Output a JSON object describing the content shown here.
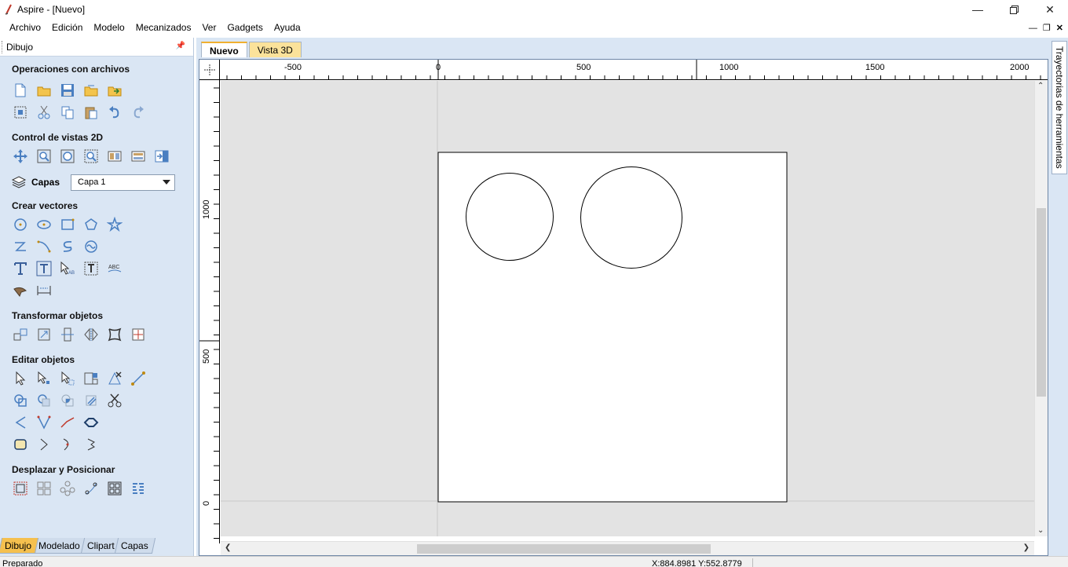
{
  "window": {
    "title": "Aspire - [Nuevo]"
  },
  "menu": [
    "Archivo",
    "Edición",
    "Modelo",
    "Mecanizados",
    "Ver",
    "Gadgets",
    "Ayuda"
  ],
  "left_panel": {
    "title": "Dibujo",
    "sections": {
      "file_ops": "Operaciones con archivos",
      "view_2d": "Control de vistas 2D",
      "create_vectors": "Crear vectores",
      "transform": "Transformar objetos",
      "edit": "Editar objetos",
      "nest": "Desplazar y Posicionar"
    },
    "layers": {
      "label": "Capas",
      "selected": "Capa 1"
    },
    "bottom_tabs": [
      "Dibujo",
      "Modelado",
      "Clipart",
      "Capas"
    ]
  },
  "doc_tabs": [
    "Nuevo",
    "Vista 3D"
  ],
  "ruler": {
    "h_labels": [
      "-500",
      "0",
      "500",
      "1000",
      "1500",
      "2000"
    ],
    "v_labels": [
      "1000",
      "500",
      "0"
    ]
  },
  "right_tab": "Trayectorias de herramientas",
  "status": {
    "left": "Preparado",
    "coords": "X:884.8981 Y:552.8779"
  },
  "colors": {
    "panel_bg": "#dae6f4",
    "active_tab": "#f5c04e",
    "canvas_bg": "#e3e3e3"
  }
}
